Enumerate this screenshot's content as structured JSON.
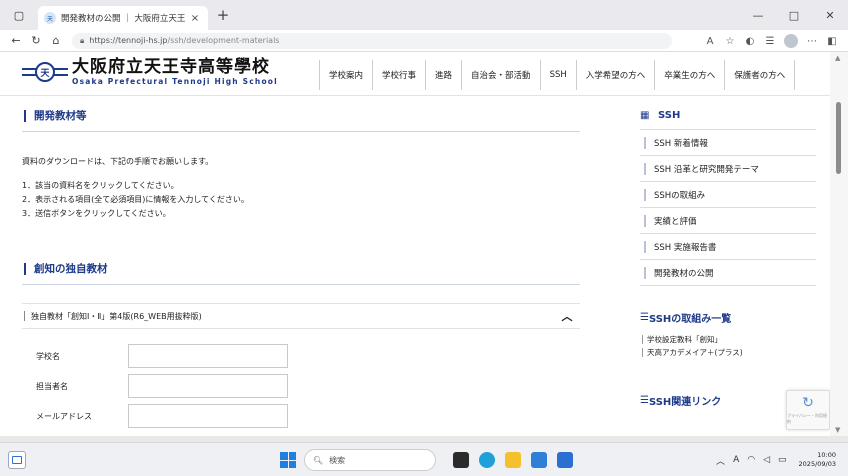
{
  "browser": {
    "tab_title": "開発教材の公開 ｜ 大阪府立天王",
    "tab_close": "×",
    "new_tab": "+",
    "url_host": "https://tennoji-hs.jp",
    "url_path": "/ssh/development-materials",
    "win_min": "—",
    "win_max": "□",
    "win_close": "✕"
  },
  "site": {
    "logo_jp": "大阪府立天王寺高等學校",
    "logo_en": "Osaka Prefectural Tennoji High School",
    "logo_mark": "天",
    "nav": [
      "学校案内",
      "学校行事",
      "進路",
      "自治会・部活動",
      "SSH",
      "入学希望の方へ",
      "卒業生の方へ",
      "保護者の方へ"
    ]
  },
  "main": {
    "heading": "開発教材等",
    "intro": "資料のダウンロードは、下記の手順でお願いします。",
    "steps": [
      "1．該当の資料名をクリックしてください。",
      "2．表示される項目(全て必須項目)に情報を入力してください。",
      "3．送信ボタンをクリックしてください。"
    ],
    "section_title": "創知の独自教材",
    "accordion_label": "独自教材「創知Ⅰ・Ⅱ」第4版(R6_WEB用抜粋版)",
    "accordion_chevron": "︿",
    "form": {
      "school_label": "学校名",
      "person_label": "担当者名",
      "email_label": "メールアドレス"
    }
  },
  "sidebar": {
    "title": "SSH",
    "items": [
      "SSH 新着情報",
      "SSH 沿革と研究開発テーマ",
      "SSHの取組み",
      "実績と評価",
      "SSH 実施報告書",
      "開発教材の公開"
    ],
    "list_title": "SSHの取組み一覧",
    "list_items": [
      "学校設定教科「創知」",
      "天高アカデメイア＋(プラス)"
    ],
    "links_title": "SSH関連リンク"
  },
  "recaptcha": {
    "text": "プライバシー・利用規約"
  },
  "taskbar": {
    "search": "検索",
    "time": "10:00",
    "date": "2025/09/03",
    "ime": "A"
  },
  "colors": {
    "accent": "#1e3a8a"
  }
}
